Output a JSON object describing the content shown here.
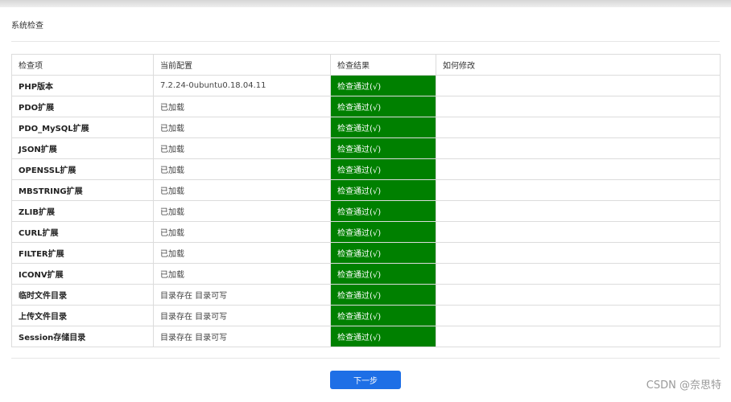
{
  "panel": {
    "title": "系统检查"
  },
  "table": {
    "headers": [
      "检查项",
      "当前配置",
      "检查结果",
      "如何修改"
    ],
    "rows": [
      {
        "item": "PHP版本",
        "config": "7.2.24-0ubuntu0.18.04.11",
        "result": "检查通过(√)",
        "fix": ""
      },
      {
        "item": "PDO扩展",
        "config": "已加载",
        "result": "检查通过(√)",
        "fix": ""
      },
      {
        "item": "PDO_MySQL扩展",
        "config": "已加载",
        "result": "检查通过(√)",
        "fix": ""
      },
      {
        "item": "JSON扩展",
        "config": "已加载",
        "result": "检查通过(√)",
        "fix": ""
      },
      {
        "item": "OPENSSL扩展",
        "config": "已加载",
        "result": "检查通过(√)",
        "fix": ""
      },
      {
        "item": "MBSTRING扩展",
        "config": "已加载",
        "result": "检查通过(√)",
        "fix": ""
      },
      {
        "item": "ZLIB扩展",
        "config": "已加载",
        "result": "检查通过(√)",
        "fix": ""
      },
      {
        "item": "CURL扩展",
        "config": "已加载",
        "result": "检查通过(√)",
        "fix": ""
      },
      {
        "item": "FILTER扩展",
        "config": "已加载",
        "result": "检查通过(√)",
        "fix": ""
      },
      {
        "item": "ICONV扩展",
        "config": "已加载",
        "result": "检查通过(√)",
        "fix": ""
      },
      {
        "item": "临时文件目录",
        "config": "目录存在 目录可写",
        "result": "检查通过(√)",
        "fix": ""
      },
      {
        "item": "上传文件目录",
        "config": "目录存在 目录可写",
        "result": "检查通过(√)",
        "fix": ""
      },
      {
        "item": "Session存储目录",
        "config": "目录存在 目录可写",
        "result": "检查通过(√)",
        "fix": ""
      }
    ]
  },
  "footer": {
    "next_label": "下一步"
  },
  "watermark": "CSDN @奈思特",
  "colors": {
    "pass": "#008000",
    "primary_button": "#1e6fe6"
  }
}
